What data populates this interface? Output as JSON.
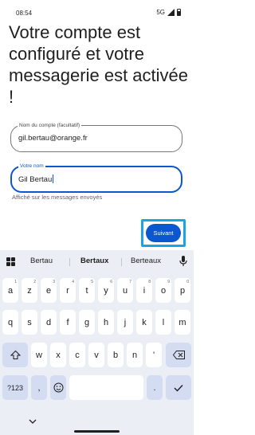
{
  "status": {
    "time": "08:54",
    "network": "5G"
  },
  "heading": "Votre compte est configuré et votre messagerie est activée !",
  "account_field": {
    "label": "Nom du compte (facultatif)",
    "value": "gil.bertau@orange.fr"
  },
  "name_field": {
    "label": "Votre nom",
    "value": "Gil Bertau",
    "helper": "Affiché sur les messages envoyés"
  },
  "next_button": {
    "label": "Suivant"
  },
  "keyboard": {
    "suggestions": [
      "Bertau",
      "Bertaux",
      "Berteaux"
    ],
    "row1": [
      {
        "k": "a",
        "h": "1"
      },
      {
        "k": "z",
        "h": "2"
      },
      {
        "k": "e",
        "h": "3"
      },
      {
        "k": "r",
        "h": "4"
      },
      {
        "k": "t",
        "h": "5"
      },
      {
        "k": "y",
        "h": "6"
      },
      {
        "k": "u",
        "h": "7"
      },
      {
        "k": "i",
        "h": "8"
      },
      {
        "k": "o",
        "h": "9"
      },
      {
        "k": "p",
        "h": "0"
      }
    ],
    "row2": [
      "q",
      "s",
      "d",
      "f",
      "g",
      "h",
      "j",
      "k",
      "l",
      "m"
    ],
    "row3": [
      "w",
      "x",
      "c",
      "v",
      "b",
      "n",
      "'"
    ],
    "symbols_label": "?123",
    "comma": ",",
    "period": "."
  },
  "colors": {
    "accent": "#0b57d0",
    "highlight": "#1aa3e8",
    "keyboard_bg": "#eceef6",
    "func_key": "#d3dcf0"
  },
  "icons": [
    "signal-icon",
    "battery-icon",
    "keyboard-menu-icon",
    "mic-icon",
    "shift-icon",
    "backspace-icon",
    "emoji-icon",
    "enter-icon",
    "nav-chevron-icon"
  ]
}
